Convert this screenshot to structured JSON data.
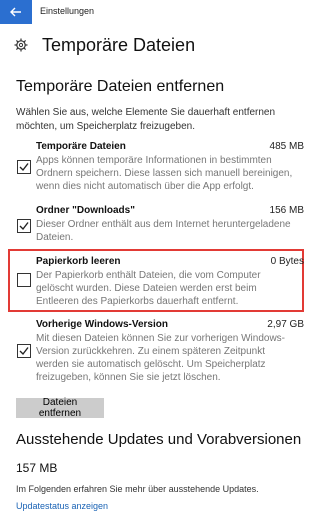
{
  "window": {
    "title": "Einstellungen"
  },
  "page": {
    "title": "Temporäre Dateien"
  },
  "section": {
    "heading": "Temporäre Dateien entfernen",
    "description": "Wählen Sie aus, welche Elemente Sie dauerhaft entfernen möchten, um Speicherplatz freizugeben."
  },
  "items": [
    {
      "title": "Temporäre Dateien",
      "size": "485 MB",
      "checked": true,
      "description": "Apps können temporäre Informationen in bestimmten Ordnern speichern. Diese lassen sich manuell bereinigen, wenn dies nicht automatisch über die App erfolgt."
    },
    {
      "title": "Ordner \"Downloads\"",
      "size": "156 MB",
      "checked": true,
      "description": "Dieser Ordner enthält aus dem Internet heruntergeladene Dateien."
    },
    {
      "title": "Papierkorb leeren",
      "size": "0 Bytes",
      "checked": false,
      "description": "Der Papierkorb enthält Dateien, die vom Computer gelöscht wurden. Diese Dateien werden erst beim Entleeren des Papierkorbs dauerhaft entfernt."
    },
    {
      "title": "Vorherige Windows-Version",
      "size": "2,97 GB",
      "checked": true,
      "description": "Mit diesen Dateien können Sie zur vorherigen Windows-Version zurückkehren. Zu einem späteren Zeitpunkt werden sie automatisch gelöscht. Um Speicherplatz freizugeben, können Sie sie jetzt löschen."
    }
  ],
  "remove_button": "Dateien entfernen",
  "updates": {
    "heading": "Ausstehende Updates und Vorabversionen",
    "size": "157 MB",
    "info": "Im Folgenden erfahren Sie mehr über ausstehende Updates.",
    "link": "Updatestatus anzeigen"
  },
  "colors": {
    "accent": "#2b6fd0",
    "highlight": "#e23a35",
    "link": "#1a63b5"
  }
}
